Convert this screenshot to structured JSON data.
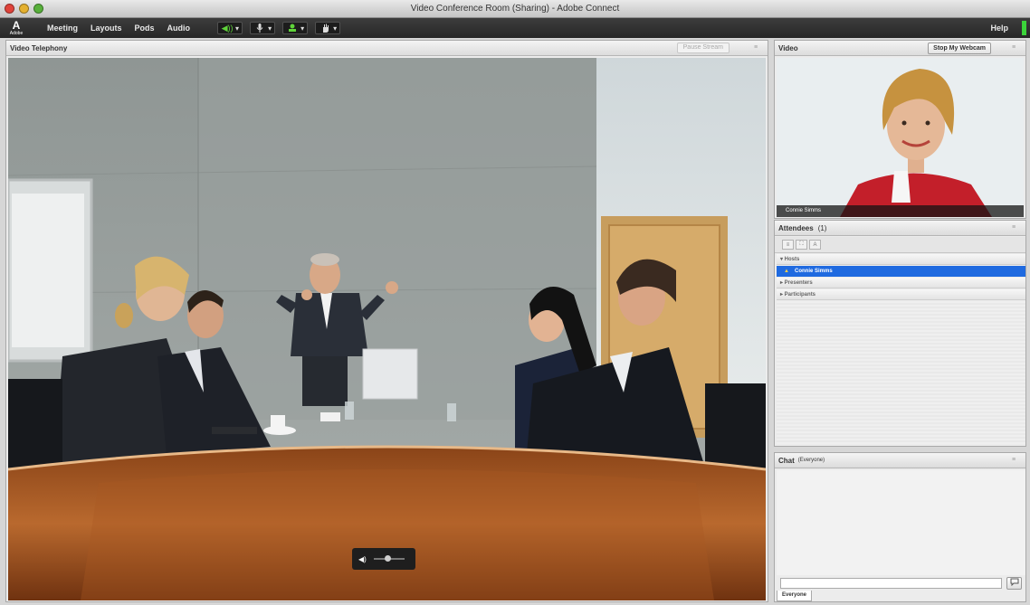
{
  "window": {
    "title": "Video Conference Room (Sharing) - Adobe Connect"
  },
  "menubar": {
    "logo_letter": "A",
    "logo_text": "Adobe",
    "items": [
      "Meeting",
      "Layouts",
      "Pods",
      "Audio"
    ],
    "tools": [
      {
        "icon": "speaker-icon",
        "glyph": "◀))"
      },
      {
        "icon": "microphone-icon",
        "glyph": "🎤"
      },
      {
        "icon": "webcam-icon",
        "glyph": "▣"
      },
      {
        "icon": "raise-hand-icon",
        "glyph": "✋"
      }
    ],
    "dropdown_glyph": "▾",
    "help": "Help"
  },
  "video_telephony_pod": {
    "title": "Video Telephony",
    "pause_button": "Pause Stream",
    "volume_slider": {
      "glyph": "◀)",
      "level": 0.45
    }
  },
  "video_pod": {
    "title": "Video",
    "stop_webcam_button": "Stop My Webcam",
    "participant_name": "Connie Simms"
  },
  "attendees_pod": {
    "title": "Attendees",
    "count": "(1)",
    "tool_glyphs": [
      "≡",
      "⛶",
      "A"
    ],
    "roles": [
      {
        "label": "▾  Hosts"
      },
      {
        "label": "▸  Presenters"
      },
      {
        "label": "▸  Participants"
      }
    ],
    "host_user": "Connie Simms"
  },
  "chat_pod": {
    "title": "Chat",
    "scope": "(Everyone)",
    "tab": "Everyone",
    "send_glyph": "💬"
  },
  "colors": {
    "selection": "#1f6ae0",
    "menubar": "#2e2e2e",
    "audio_active": "#5fd43a"
  }
}
